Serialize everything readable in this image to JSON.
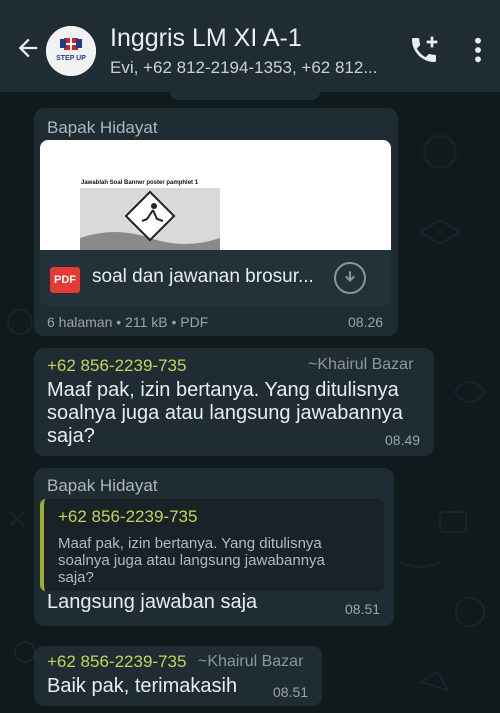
{
  "header": {
    "title": "Inggris LM XI A-1",
    "subtitle": "Evi, +62 812-2194-1353, +62 812...",
    "avatar_text": "STEP UP",
    "icons": [
      "back-arrow-icon",
      "add-call-icon",
      "more-vert-icon"
    ]
  },
  "messages": [
    {
      "sender": "Bapak Hidayat",
      "preview_title": "Jawablah Soal Banner poster pamphlet 1",
      "file_name": "soal dan jawanan brosur...",
      "file_badge": "PDF",
      "file_meta": "6 halaman • 211 kB • PDF",
      "time": "08.26"
    },
    {
      "phone": "+62 856-2239-735",
      "pushname": "~Khairul Bazar",
      "text_lines": [
        "Maaf pak, izin bertanya. Yang ditulisnya",
        "soalnya juga atau langsung jawabannya",
        "saja?"
      ],
      "time": "08.49"
    },
    {
      "sender": "Bapak Hidayat",
      "quote_phone": "+62 856-2239-735",
      "quote_lines": [
        "Maaf pak, izin bertanya. Yang ditulisnya",
        "soalnya juga atau langsung jawabannya",
        "saja?"
      ],
      "text": "Langsung jawaban saja",
      "time": "08.51"
    },
    {
      "phone": "+62 856-2239-735",
      "pushname": "~Khairul Bazar",
      "text": "Baik pak, terimakasih",
      "time": "08.51"
    }
  ],
  "colors": {
    "header_bg": "#1f2c33",
    "chat_bg": "#0f1a1d",
    "bubble_bg": "#1f2c33",
    "phone_color": "#c6d35a",
    "quote_bar": "#9fae33"
  }
}
